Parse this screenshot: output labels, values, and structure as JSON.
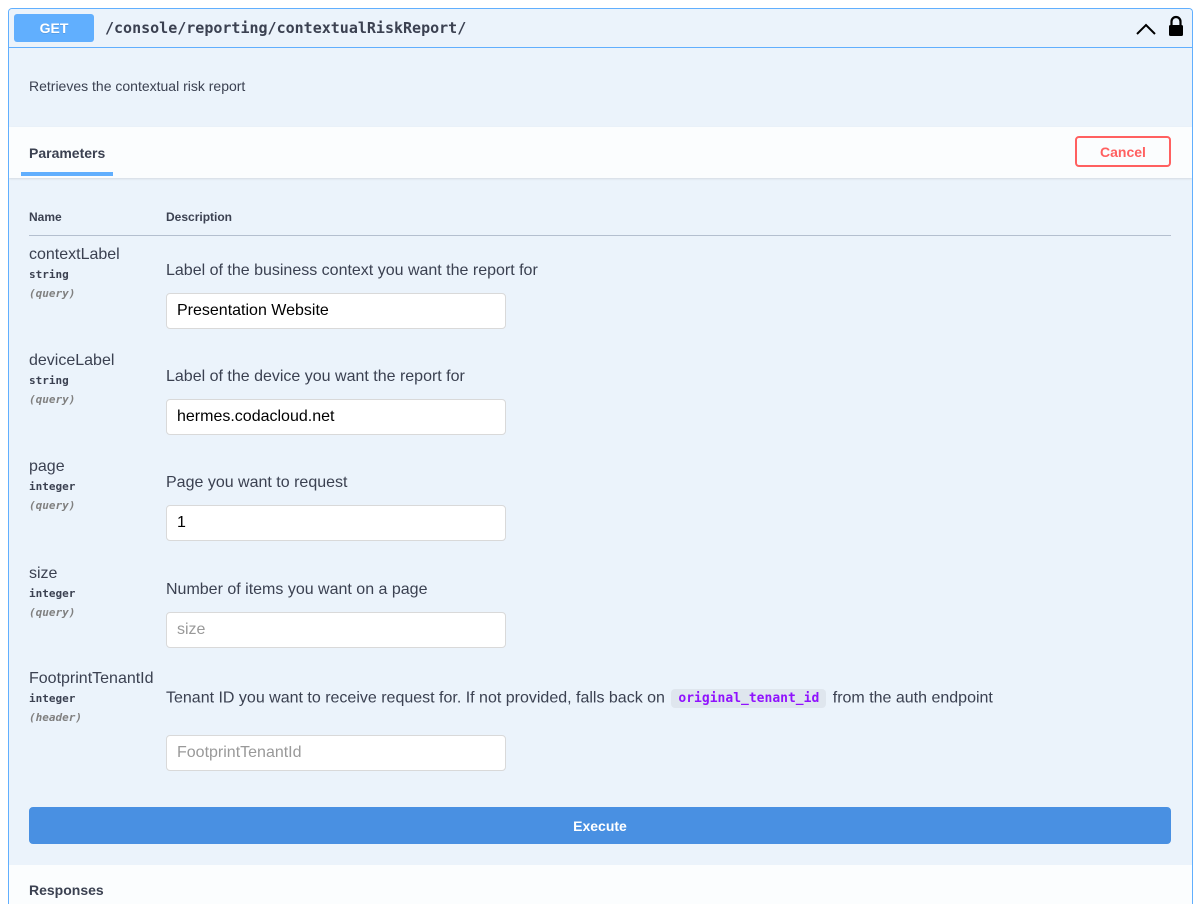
{
  "summary": {
    "method": "GET",
    "path": "/console/reporting/contextualRiskReport/"
  },
  "description": "Retrieves the contextual risk report",
  "parameters_section": {
    "tab_label": "Parameters",
    "cancel_label": "Cancel",
    "col_name": "Name",
    "col_description": "Description"
  },
  "params": [
    {
      "name": "contextLabel",
      "type": "string",
      "in": "(query)",
      "description": "Label of the business context you want the report for",
      "value": "Presentation Website",
      "placeholder": "contextLabel"
    },
    {
      "name": "deviceLabel",
      "type": "string",
      "in": "(query)",
      "description": "Label of the device you want the report for",
      "value": "hermes.codacloud.net",
      "placeholder": "deviceLabel"
    },
    {
      "name": "page",
      "type": "integer",
      "in": "(query)",
      "description": "Page you want to request",
      "value": "1",
      "placeholder": "page"
    },
    {
      "name": "size",
      "type": "integer",
      "in": "(query)",
      "description": "Number of items you want on a page",
      "value": "",
      "placeholder": "size"
    },
    {
      "name": "FootprintTenantId",
      "type": "integer",
      "in": "(header)",
      "description_prefix": "Tenant ID you want to receive request for. If not provided, falls back on",
      "description_code": "original_tenant_id",
      "description_suffix": "from the auth endpoint",
      "value": "",
      "placeholder": "FootprintTenantId"
    }
  ],
  "execute_label": "Execute",
  "responses_label": "Responses",
  "icons": {
    "collapse": "chevron-up-icon",
    "auth": "lock-icon"
  },
  "colors": {
    "get_accent": "#61affe",
    "cancel": "#ff6060",
    "execute": "#4990e2"
  }
}
